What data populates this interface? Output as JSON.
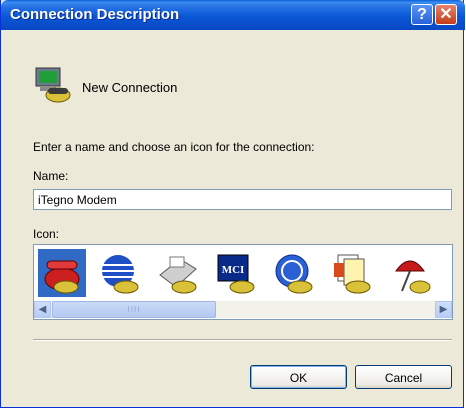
{
  "window": {
    "title": "Connection Description"
  },
  "titlebar": {
    "help_label": "?",
    "close_label": "✕"
  },
  "header": {
    "label": "New Connection"
  },
  "prompt": "Enter a name and choose an icon for the connection:",
  "name": {
    "label": "Name:",
    "value": "iTegno Modem"
  },
  "icon_picker": {
    "label": "Icon:",
    "items": [
      "red-telephone-icon",
      "striped-globe-icon",
      "fax-machine-icon",
      "mci-icon",
      "ge-icon",
      "documents-icon",
      "umbrella-icon"
    ],
    "selected_index": 0,
    "scroll_thumb_grip": "IIII"
  },
  "buttons": {
    "ok": "OK",
    "cancel": "Cancel"
  },
  "colors": {
    "titlebar": "#0a57d6",
    "selection": "#316ac5",
    "dialog_bg": "#ece9d8"
  }
}
